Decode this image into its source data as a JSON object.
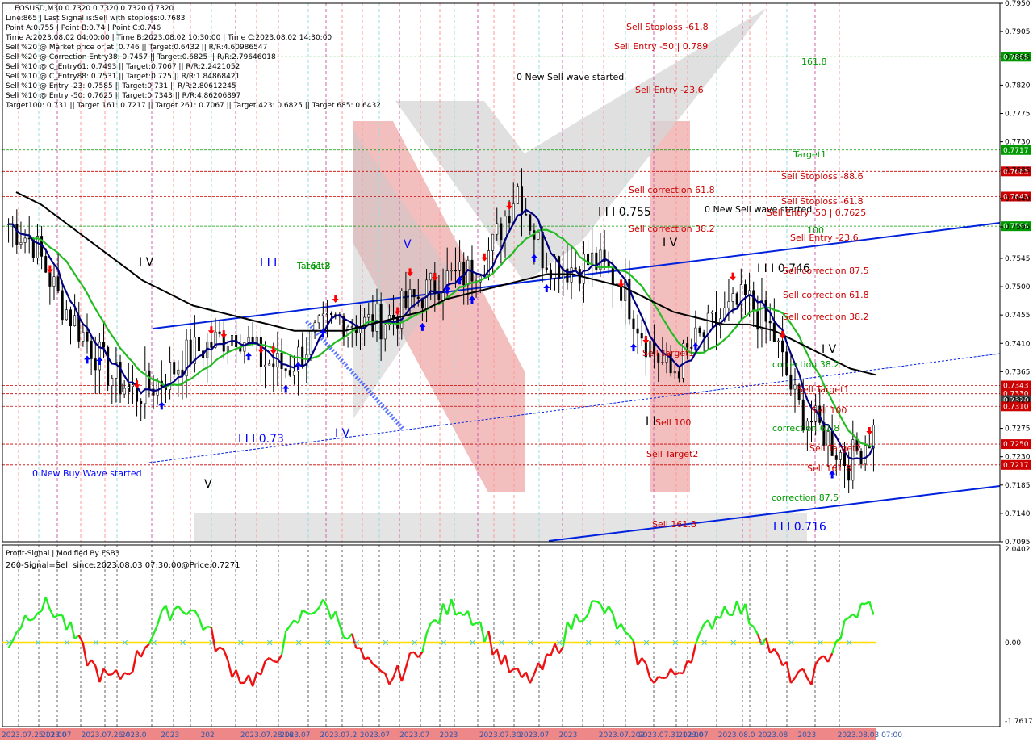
{
  "header": {
    "symbol_line": "EOSUSD,M30  0.7320 0.7320 0.7320 0.7320",
    "lines": [
      "Line:865 | Last Signal is:Sell with stoploss:0.7683",
      "Point A:0.755 | Point B:0.74 | Point C:0.746",
      "Time A:2023.08.02 04:00:00 | Time B:2023.08.02 10:30:00 | Time C:2023.08.02 14:30:00",
      "Sell %20 @ Market price or at: 0.746 || Target:0.6432 || R/R:4.60986547",
      "Sell %20 @ Correction Entry38: 0.7457 || Target:0.6825 || R/R:2.79646018",
      "Sell %10 @ C_Entry61: 0.7493 || Target:0.7067 || R/R:2.2421052",
      "Sell %10 @ C_Entry88: 0.7531 || Target:0.725 || R/R:1.84868421",
      "Sell %10 @ Entry -23: 0.7585 || Target:0.731 || R/R:2.80612245",
      "Sell %10 @ Entry -50: 0.7625 || Target:0.7343 || R/R:4.86206897",
      "Target100: 0.731 || Target 161: 0.7217 || Target 261: 0.7067 || Target 423: 0.6825 || Target 685: 0.6432"
    ]
  },
  "indicator": {
    "title": "Profit-Signal | Modified By FSB3",
    "signal": "260-Signal=Sell since:2023.08.03 07:30:00@Price:0.7271",
    "scale": [
      "2.0402",
      "0.00",
      "-1.7617"
    ]
  },
  "colors": {
    "bg": "#ffffff",
    "grid": "#c8c8c8",
    "bull": "#0000ff",
    "bear": "#ff0000",
    "wick": "#000000",
    "ma_fast": "#000080",
    "ma_mid": "#22bb22",
    "ma_slow": "#000000",
    "channel": "#0022dd",
    "level_red": "#cc0000",
    "level_green": "#009900"
  },
  "chart_data": {
    "type": "line",
    "title": "EOSUSD,M30",
    "xlabel": "",
    "ylabel": "",
    "ylim": [
      0.7095,
      0.795
    ],
    "y_ticks": [
      "0.7950",
      "0.7905",
      "0.7865",
      "0.7820",
      "0.7775",
      "0.7730",
      "0.7685",
      "0.7640",
      "0.7595",
      "0.7545",
      "0.7500",
      "0.7455",
      "0.7410",
      "0.7365",
      "0.7320",
      "0.7275",
      "0.7230",
      "0.7185",
      "0.7140",
      "0.7095"
    ],
    "x_labels": [
      "2023.07.25 12:00",
      "2023.07",
      "2023.07.26 4",
      "2023.0",
      "2023",
      "202",
      "2023.07.28 16",
      "2023.07",
      "2023.07.2",
      "2023.07",
      "2023.07",
      "2023",
      "2023.07.30",
      "2023.07",
      "2023",
      "2023.07.202",
      "2023.07.31 12:00",
      "2023.07",
      "2023.08.0",
      "2023.08",
      "2023",
      "2023.08.03 07:00"
    ],
    "price_series": [
      0.76,
      0.757,
      0.748,
      0.742,
      0.736,
      0.733,
      0.735,
      0.739,
      0.741,
      0.743,
      0.738,
      0.737,
      0.742,
      0.745,
      0.744,
      0.745,
      0.748,
      0.751,
      0.752,
      0.756,
      0.766,
      0.755,
      0.753,
      0.754,
      0.751,
      0.742,
      0.736,
      0.741,
      0.745,
      0.748,
      0.743,
      0.731,
      0.727,
      0.722,
      0.7271
    ],
    "ma_slow": [
      0.765,
      0.763,
      0.76,
      0.757,
      0.754,
      0.751,
      0.749,
      0.747,
      0.746,
      0.745,
      0.744,
      0.743,
      0.743,
      0.743,
      0.744,
      0.745,
      0.746,
      0.748,
      0.749,
      0.75,
      0.751,
      0.752,
      0.752,
      0.751,
      0.75,
      0.748,
      0.746,
      0.745,
      0.744,
      0.744,
      0.743,
      0.741,
      0.739,
      0.737,
      0.736
    ],
    "levels": [
      {
        "price": 0.7865,
        "label": "0.7865",
        "color": "#009900"
      },
      {
        "price": 0.7717,
        "label": "0.7717",
        "color": "#009900"
      },
      {
        "price": 0.7683,
        "label": "0.7683",
        "color": "#cc0000"
      },
      {
        "price": 0.7643,
        "label": "0.7643",
        "color": "#cc0000"
      },
      {
        "price": 0.7596,
        "label": "0.7596",
        "color": "#009900"
      },
      {
        "price": 0.7343,
        "label": "0.7343",
        "color": "#cc0000"
      },
      {
        "price": 0.733,
        "label": "0.7330",
        "color": "#cc0000"
      },
      {
        "price": 0.732,
        "label": "0.7320",
        "color": "#444444"
      },
      {
        "price": 0.731,
        "label": "0.7310",
        "color": "#cc0000"
      },
      {
        "price": 0.725,
        "label": "0.7250",
        "color": "#cc0000"
      },
      {
        "price": 0.7217,
        "label": "0.7217",
        "color": "#cc0000"
      }
    ],
    "annotations": [
      {
        "text": "Sell Stoploss -61.8",
        "color": "#cc0000"
      },
      {
        "text": "Sell Entry -50 | 0.789",
        "color": "#cc0000"
      },
      {
        "text": "0 New Sell wave started",
        "color": "#000000"
      },
      {
        "text": "Sell Entry -23.6",
        "color": "#cc0000"
      },
      {
        "text": "161.8",
        "color": "#009900"
      },
      {
        "text": "Target1",
        "color": "#009900"
      },
      {
        "text": "Sell Stoploss -88.6",
        "color": "#cc0000"
      },
      {
        "text": "Sell correction 61.8",
        "color": "#cc0000"
      },
      {
        "text": "Sell Stoploss -61.8",
        "color": "#cc0000"
      },
      {
        "text": "I I I 0.755",
        "color": "#000000"
      },
      {
        "text": "0 New Sell wave started",
        "color": "#000000"
      },
      {
        "text": "Sell Entry -50 | 0.7625",
        "color": "#cc0000"
      },
      {
        "text": "Sell correction 38.2",
        "color": "#cc0000"
      },
      {
        "text": "100",
        "color": "#009900"
      },
      {
        "text": "Sell Entry -23.6",
        "color": "#cc0000"
      },
      {
        "text": "I V",
        "color": "#000000"
      },
      {
        "text": "I I I 0.746",
        "color": "#000000"
      },
      {
        "text": "Sell correction 87.5",
        "color": "#cc0000"
      },
      {
        "text": "Sell correction 61.8",
        "color": "#cc0000"
      },
      {
        "text": "Sell correction 38.2",
        "color": "#cc0000"
      },
      {
        "text": "I V",
        "color": "#000000"
      },
      {
        "text": "Sell Target1",
        "color": "#cc0000"
      },
      {
        "text": "correction 38.2",
        "color": "#009900"
      },
      {
        "text": "Sell Target1",
        "color": "#cc0000"
      },
      {
        "text": "I I",
        "color": "#000000"
      },
      {
        "text": "Sell 100",
        "color": "#cc0000"
      },
      {
        "text": "Sell 100",
        "color": "#cc0000"
      },
      {
        "text": "correction 61.8",
        "color": "#009900"
      },
      {
        "text": "Sell Target2",
        "color": "#cc0000"
      },
      {
        "text": "Sell Target2",
        "color": "#cc0000"
      },
      {
        "text": "Sell 161.8",
        "color": "#cc0000"
      },
      {
        "text": "correction 87.5",
        "color": "#009900"
      },
      {
        "text": "Sell 161.8",
        "color": "#cc0000"
      },
      {
        "text": "I I I 0.716",
        "color": "#0000ff"
      },
      {
        "text": "I V",
        "color": "#000000"
      },
      {
        "text": "I I I 0.73",
        "color": "#0000ff"
      },
      {
        "text": "I V",
        "color": "#0000ff"
      },
      {
        "text": "0 New Buy Wave started",
        "color": "#0000ff"
      },
      {
        "text": "V",
        "color": "#000000"
      },
      {
        "text": "I I",
        "color": "#000000"
      },
      {
        "text": "I I I",
        "color": "#0000ff"
      },
      {
        "text": "Target2",
        "color": "#009900"
      },
      {
        "text": "161.8",
        "color": "#009900"
      },
      {
        "text": "V",
        "color": "#0000ff"
      }
    ]
  }
}
